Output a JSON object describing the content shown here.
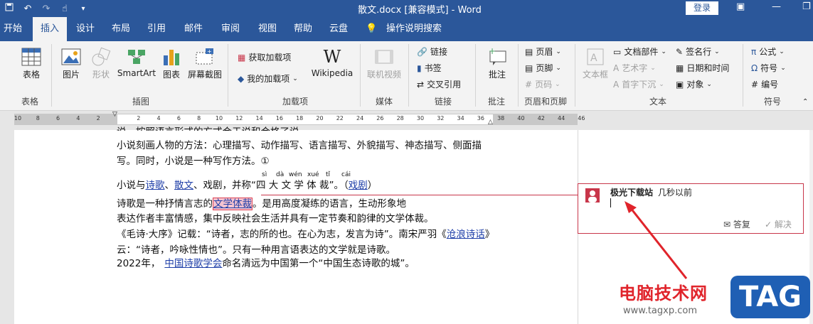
{
  "titlebar": {
    "title": "散文.docx [兼容模式] - Word",
    "login": "登录",
    "qat_icons": [
      "save-icon",
      "undo-icon",
      "redo-icon",
      "touch-mode-icon",
      "customize-icon"
    ]
  },
  "tabs": [
    "开始",
    "插入",
    "设计",
    "布局",
    "引用",
    "邮件",
    "审阅",
    "视图",
    "帮助",
    "云盘",
    "操作说明搜索"
  ],
  "ribbon": {
    "table": {
      "label": "表格",
      "group": "表格"
    },
    "illustrations": {
      "picture": "图片",
      "shapes": "形状",
      "smartart": "SmartArt",
      "chart": "图表",
      "screenshot": "屏幕截图",
      "group": "插图"
    },
    "addins": {
      "get": "获取加载项",
      "my": "我的加载项",
      "wikipedia": "Wikipedia",
      "group": "加载项"
    },
    "media": {
      "online_video": "联机视频",
      "group": "媒体"
    },
    "links": {
      "link": "链接",
      "bookmark": "书签",
      "cross_ref": "交叉引用",
      "group": "链接"
    },
    "comments": {
      "comment": "批注",
      "group": "批注"
    },
    "header_footer": {
      "header": "页眉",
      "footer": "页脚",
      "page_number": "页码",
      "group": "页眉和页脚"
    },
    "text": {
      "textbox": "文本框",
      "doc_parts": "文档部件",
      "wordart": "艺术字",
      "dropcap": "首字下沉",
      "signature": "签名行",
      "datetime": "日期和时间",
      "object": "对象",
      "group": "文本"
    },
    "symbols": {
      "equation": "公式",
      "symbol": "符号",
      "numbering": "编号",
      "group": "符号"
    }
  },
  "ruler": {
    "numbers": [
      "10",
      "8",
      "6",
      "4",
      "2",
      "",
      "2",
      "4",
      "6",
      "8",
      "10",
      "12",
      "14",
      "16",
      "18",
      "20",
      "22",
      "24",
      "26",
      "28",
      "30",
      "32",
      "34",
      "36",
      "38",
      "40",
      "42",
      "44",
      "46"
    ]
  },
  "document": {
    "line0": "说，按照语言形式的方式合于说和合格了说。",
    "line1": "小说刻画人物的方法：心理描写、动作描写、语言描写、外貌描写、神态描写、侧面描",
    "line2": "写。同时，小说是一种写作方法。①",
    "line3_a": "小说与",
    "line3_link1": "诗歌",
    "line3_b": "、",
    "line3_link2": "散文",
    "line3_c": "、戏剧，并称“四 大 文 学 体 裁”。（",
    "line3_link3": "戏剧",
    "line3_d": "）",
    "pinyin": [
      "sì",
      "dà",
      "wén",
      "xué",
      "tǐ",
      "cái"
    ],
    "line4_a": "诗歌是一种抒情言志的",
    "line4_hl": "文学体裁",
    "line4_b": "。是用高度凝练的语言，生动形象地",
    "line5": "表达作者丰富情感，集中反映社会生活并具有一定节奏和韵律的文学体裁。",
    "line6_a": "《毛诗·大序》记载：“诗者，志的所的也。在心为志，发言为诗”。南宋严羽《",
    "line6_link": "沧浪诗话",
    "line6_b": "》",
    "line7": "云：“诗者，吟咏性情也”。只有一种用言语表达的文学就是诗歌。",
    "line8_a": "2022年，",
    "line8_link": "中国诗歌学会",
    "line8_b": "命名清远为中国第一个“中国生态诗歌的城”。"
  },
  "comment": {
    "author": "极光下载站",
    "time": "几秒以前",
    "reply": "答复",
    "resolve": "解决"
  },
  "watermark": {
    "text": "电脑技术网",
    "url": "www.tagxp.com",
    "tag": "TAG"
  },
  "colors": {
    "accent": "#2b579a",
    "comment": "#c8364a",
    "link": "#1f3fa8"
  }
}
